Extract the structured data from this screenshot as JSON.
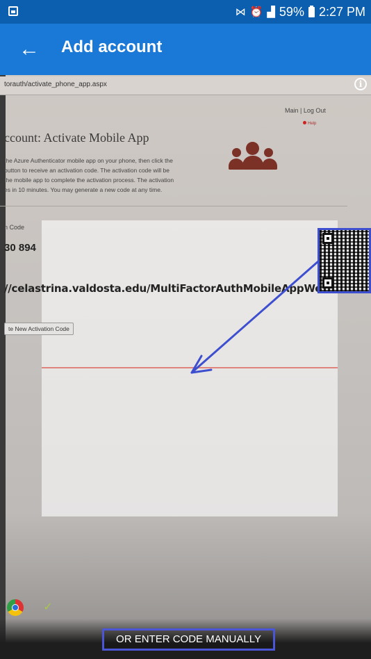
{
  "status_bar": {
    "battery_percent": "59%",
    "time": "2:27 PM"
  },
  "app_bar": {
    "title": "Add account"
  },
  "camera_view": {
    "url_text": "torauth/activate_phone_app.aspx",
    "nav_links": "Main | Log Out",
    "help_link": "Help",
    "page_heading": "ccount: Activate Mobile App",
    "instructions": [
      "the Azure Authenticator mobile app on your phone, then click the",
      "button to receive an activation code. The activation code will be",
      "the mobile app to complete the activation process. The activation",
      "es in 10 minutes. You may generate a new code at any time."
    ],
    "code_label": "n Code",
    "code_value": "30 894",
    "service_url": "//celastrina.valdosta.edu/MultiFactorAuthMobileAppWebService",
    "generate_button": "te New Activation Code"
  },
  "manual_entry": {
    "label": "OR ENTER CODE MANUALLY"
  },
  "colors": {
    "status_bar": "#0b5fae",
    "app_bar": "#1a78d6",
    "annotation": "#3d4fcf",
    "scan_line": "#e0837d"
  }
}
